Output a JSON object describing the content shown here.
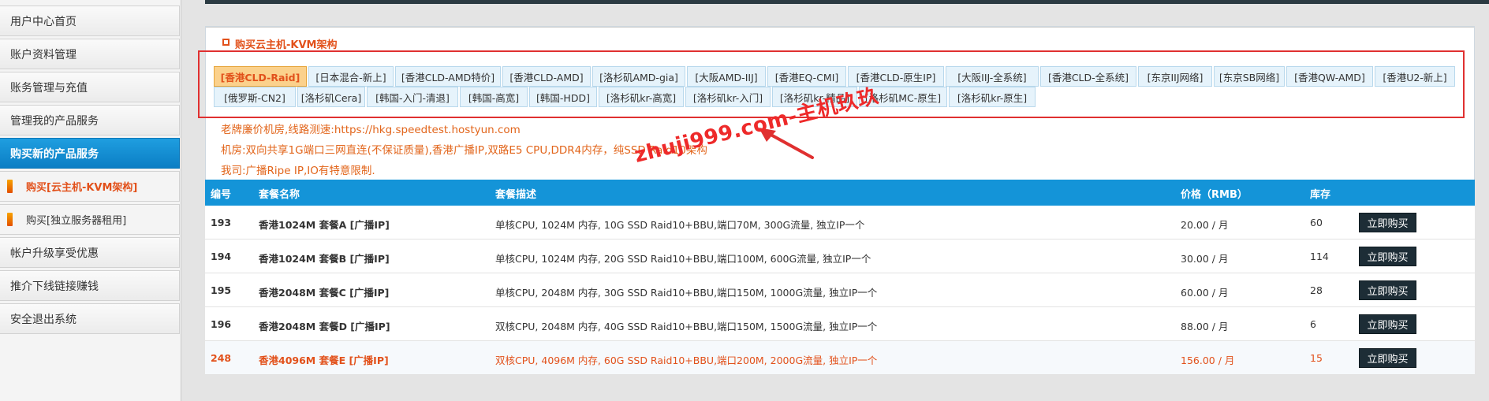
{
  "sidebar": {
    "items": [
      {
        "label": "用户中心首页"
      },
      {
        "label": "账户资料管理"
      },
      {
        "label": "账务管理与充值"
      },
      {
        "label": "管理我的产品服务"
      },
      {
        "label": "购买新的产品服务"
      },
      {
        "label": "购买[云主机-KVM架构]"
      },
      {
        "label": "购买[独立服务器租用]"
      },
      {
        "label": "帐户升级享受优惠"
      },
      {
        "label": "推介下线链接赚钱"
      },
      {
        "label": "安全退出系统"
      }
    ]
  },
  "panel": {
    "title": "购买云主机-KVM架构"
  },
  "tabs": [
    {
      "label": "[香港CLD-Raid]",
      "active": true
    },
    {
      "label": "[日本混合-新上]"
    },
    {
      "label": "[香港CLD-AMD特价]"
    },
    {
      "label": "[香港CLD-AMD]"
    },
    {
      "label": "[洛杉矶AMD-gia]"
    },
    {
      "label": "[大阪AMD-IIJ]"
    },
    {
      "label": "[香港EQ-CMI]"
    },
    {
      "label": "[香港CLD-原生IP]"
    },
    {
      "label": "[大阪IIJ-全系统]"
    },
    {
      "label": "[香港CLD-全系统]"
    },
    {
      "label": "[东京IIJ网络]"
    },
    {
      "label": "[东京SB网络]"
    },
    {
      "label": "[香港QW-AMD]"
    },
    {
      "label": "[香港U2-新上]"
    },
    {
      "label": "[俄罗斯-CN2]"
    },
    {
      "label": "[洛杉矶Cera]"
    },
    {
      "label": "[韩国-入门-清退]"
    },
    {
      "label": "[韩国-高宽]"
    },
    {
      "label": "[韩国-HDD]"
    },
    {
      "label": "[洛杉矶kr-高宽]"
    },
    {
      "label": "[洛杉矶kr-入门]"
    },
    {
      "label": "[洛杉矶kr-精品]"
    },
    {
      "label": "[洛杉矶MC-原生]"
    },
    {
      "label": "[洛杉矶kr-原生]"
    }
  ],
  "notices": [
    "老牌廉价机房,线路测速:https://hkg.speedtest.hostyun.com",
    "机房:双向共享1G端口三网直连(不保证质量),香港广播IP,双路E5 CPU,DDR4内存，纯SSD Raid10架构",
    "我司:广播Ripe IP,IO有特意限制."
  ],
  "watermark": "zhuji999.com-主机玖玖",
  "table": {
    "headers": {
      "id": "编号",
      "name": "套餐名称",
      "desc": "套餐描述",
      "price": "价格（RMB）",
      "stock": "库存"
    },
    "rows": [
      {
        "id": "193",
        "name": "香港1024M 套餐A [广播IP]",
        "desc": "单核CPU, 1024M 内存, 10G SSD Raid10+BBU,端口70M, 300G流量, 独立IP一个",
        "price": "20.00 / 月",
        "stock": "60",
        "button": "立即购买"
      },
      {
        "id": "194",
        "name": "香港1024M 套餐B [广播IP]",
        "desc": "单核CPU, 1024M 内存, 20G SSD Raid10+BBU,端口100M, 600G流量, 独立IP一个",
        "price": "30.00 / 月",
        "stock": "114",
        "button": "立即购买"
      },
      {
        "id": "195",
        "name": "香港2048M 套餐C [广播IP]",
        "desc": "单核CPU, 2048M 内存, 30G SSD Raid10+BBU,端口150M, 1000G流量, 独立IP一个",
        "price": "60.00 / 月",
        "stock": "28",
        "button": "立即购买"
      },
      {
        "id": "196",
        "name": "香港2048M 套餐D [广播IP]",
        "desc": "双核CPU, 2048M 内存, 40G SSD Raid10+BBU,端口150M, 1500G流量, 独立IP一个",
        "price": "88.00 / 月",
        "stock": "6",
        "button": "立即购买"
      },
      {
        "id": "248",
        "name": "香港4096M 套餐E [广播IP]",
        "desc": "双核CPU, 4096M 内存, 60G SSD Raid10+BBU,端口200M, 2000G流量, 独立IP一个",
        "price": "156.00 / 月",
        "stock": "15",
        "button": "立即购买"
      }
    ]
  },
  "colors": {
    "accent": "#1494d8",
    "highlight": "#e2511b",
    "annotation": "#e03030",
    "button": "#1d2d36"
  }
}
